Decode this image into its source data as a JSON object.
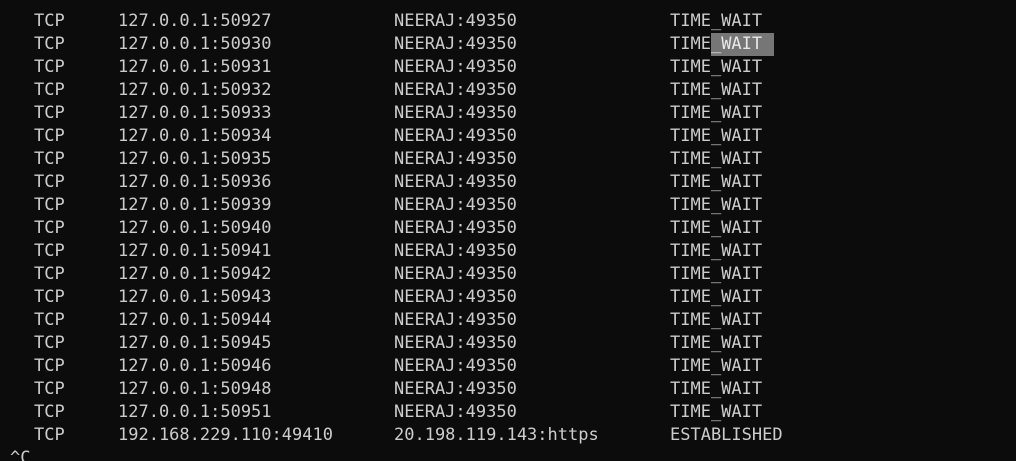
{
  "terminal": {
    "connections": [
      {
        "proto": "TCP",
        "local": "127.0.0.1:50927",
        "foreign": "NEERAJ:49350",
        "state": "TIME_WAIT"
      },
      {
        "proto": "TCP",
        "local": "127.0.0.1:50930",
        "foreign": "NEERAJ:49350",
        "state_prefix": "TIME",
        "state_selected": "_WAIT"
      },
      {
        "proto": "TCP",
        "local": "127.0.0.1:50931",
        "foreign": "NEERAJ:49350",
        "state": "TIME_WAIT"
      },
      {
        "proto": "TCP",
        "local": "127.0.0.1:50932",
        "foreign": "NEERAJ:49350",
        "state": "TIME_WAIT"
      },
      {
        "proto": "TCP",
        "local": "127.0.0.1:50933",
        "foreign": "NEERAJ:49350",
        "state": "TIME_WAIT"
      },
      {
        "proto": "TCP",
        "local": "127.0.0.1:50934",
        "foreign": "NEERAJ:49350",
        "state": "TIME_WAIT"
      },
      {
        "proto": "TCP",
        "local": "127.0.0.1:50935",
        "foreign": "NEERAJ:49350",
        "state": "TIME_WAIT"
      },
      {
        "proto": "TCP",
        "local": "127.0.0.1:50936",
        "foreign": "NEERAJ:49350",
        "state": "TIME_WAIT"
      },
      {
        "proto": "TCP",
        "local": "127.0.0.1:50939",
        "foreign": "NEERAJ:49350",
        "state": "TIME_WAIT"
      },
      {
        "proto": "TCP",
        "local": "127.0.0.1:50940",
        "foreign": "NEERAJ:49350",
        "state": "TIME_WAIT"
      },
      {
        "proto": "TCP",
        "local": "127.0.0.1:50941",
        "foreign": "NEERAJ:49350",
        "state": "TIME_WAIT"
      },
      {
        "proto": "TCP",
        "local": "127.0.0.1:50942",
        "foreign": "NEERAJ:49350",
        "state": "TIME_WAIT"
      },
      {
        "proto": "TCP",
        "local": "127.0.0.1:50943",
        "foreign": "NEERAJ:49350",
        "state": "TIME_WAIT"
      },
      {
        "proto": "TCP",
        "local": "127.0.0.1:50944",
        "foreign": "NEERAJ:49350",
        "state": "TIME_WAIT"
      },
      {
        "proto": "TCP",
        "local": "127.0.0.1:50945",
        "foreign": "NEERAJ:49350",
        "state": "TIME_WAIT"
      },
      {
        "proto": "TCP",
        "local": "127.0.0.1:50946",
        "foreign": "NEERAJ:49350",
        "state": "TIME_WAIT"
      },
      {
        "proto": "TCP",
        "local": "127.0.0.1:50948",
        "foreign": "NEERAJ:49350",
        "state": "TIME_WAIT"
      },
      {
        "proto": "TCP",
        "local": "127.0.0.1:50951",
        "foreign": "NEERAJ:49350",
        "state": "TIME_WAIT"
      },
      {
        "proto": "TCP",
        "local": "192.168.229.110:49410",
        "foreign": "20.198.119.143:https",
        "state": "ESTABLISHED"
      }
    ],
    "prompt": "^C",
    "colors": {
      "background": "#0c0c0c",
      "text": "#cccccc",
      "selection": "#767676"
    }
  }
}
